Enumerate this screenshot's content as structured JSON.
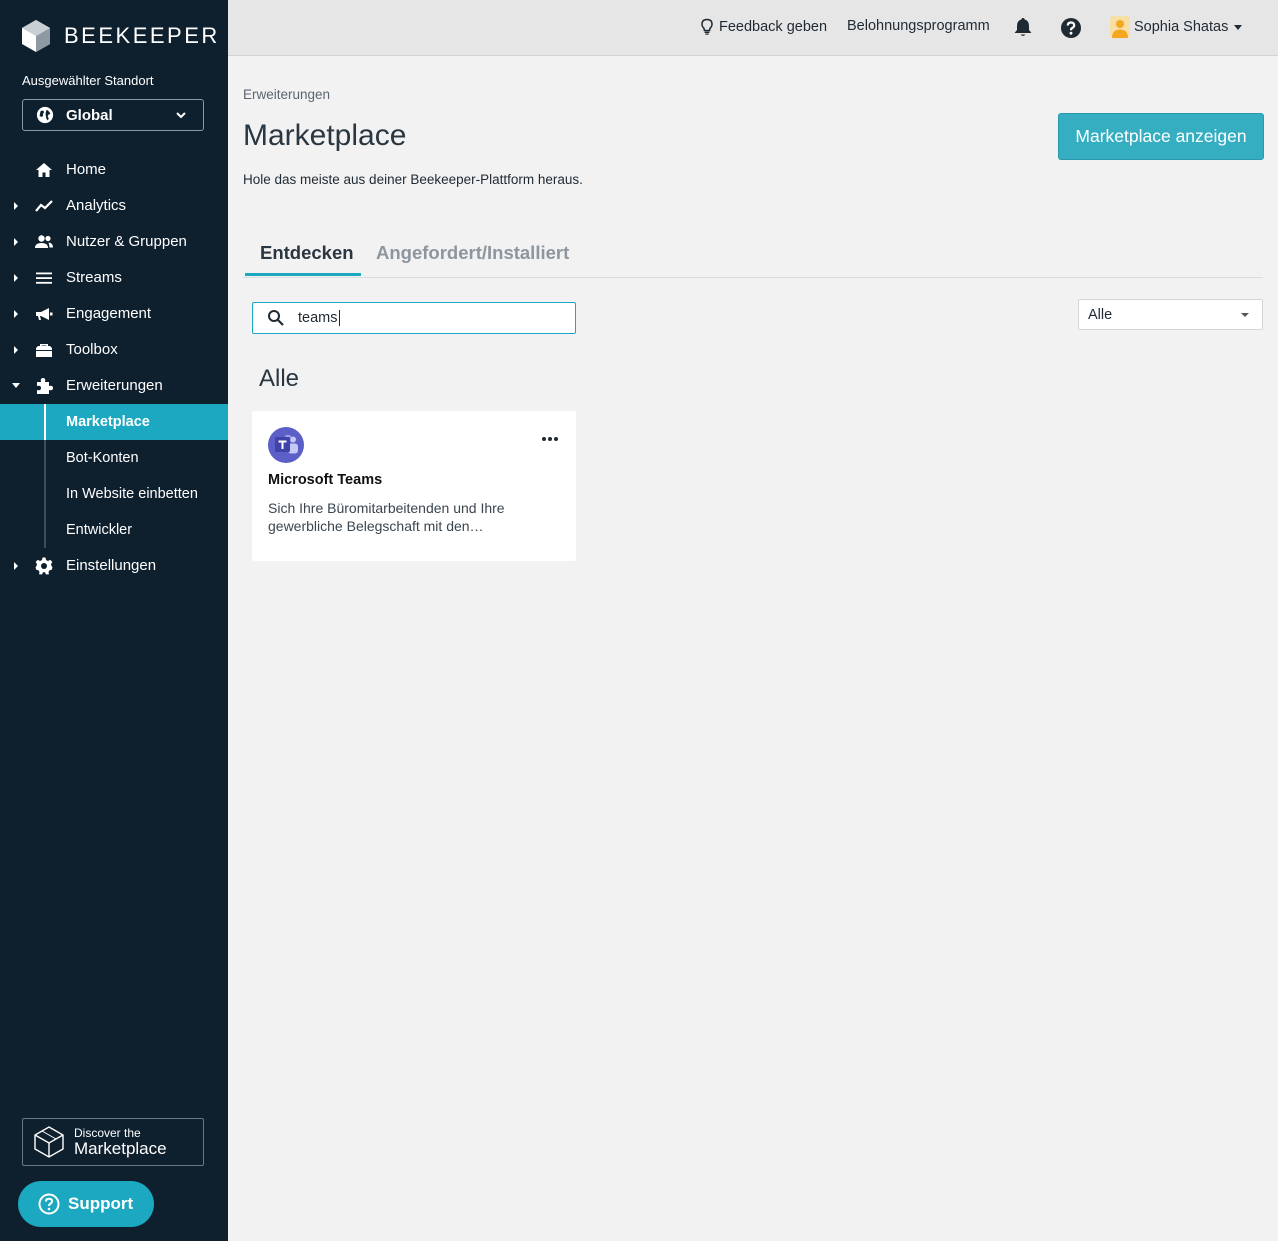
{
  "app": {
    "brand": "BEEKEEPER"
  },
  "sidebar": {
    "location_label": "Ausgewählter Standort",
    "location_value": "Global",
    "items": [
      {
        "label": "Home",
        "icon": "home-icon"
      },
      {
        "label": "Analytics",
        "icon": "analytics-icon"
      },
      {
        "label": "Nutzer & Gruppen",
        "icon": "users-icon"
      },
      {
        "label": "Streams",
        "icon": "streams-icon"
      },
      {
        "label": "Engagement",
        "icon": "megaphone-icon"
      },
      {
        "label": "Toolbox",
        "icon": "toolbox-icon"
      },
      {
        "label": "Erweiterungen",
        "icon": "puzzle-icon"
      },
      {
        "label": "Einstellungen",
        "icon": "gear-icon"
      }
    ],
    "subitems": [
      {
        "label": "Marketplace",
        "active": true
      },
      {
        "label": "Bot-Konten"
      },
      {
        "label": "In Website einbetten"
      },
      {
        "label": "Entwickler"
      }
    ],
    "discover": {
      "line1": "Discover the",
      "line2": "Marketplace"
    },
    "support_label": "Support"
  },
  "topbar": {
    "feedback": "Feedback geben",
    "rewards": "Belohnungsprogramm",
    "user_name": "Sophia Shatas"
  },
  "main": {
    "breadcrumb": "Erweiterungen",
    "title": "Marketplace",
    "subtitle": "Hole das meiste aus deiner Beekeeper-Plattform heraus.",
    "cta_button": "Marketplace anzeigen",
    "tabs": [
      {
        "label": "Entdecken",
        "active": true
      },
      {
        "label": "Angefordert/Installiert",
        "active": false
      }
    ],
    "search_value": "teams",
    "filter_value": "Alle",
    "section_title": "Alle",
    "cards": [
      {
        "title": "Microsoft Teams",
        "description": "Sich Ihre Büromitarbeitenden und Ihre gewerbliche Belegschaft mit den…",
        "icon": "microsoft-teams-icon"
      }
    ]
  },
  "colors": {
    "sidebar_bg": "#0e1f2e",
    "accent": "#1ba8c0",
    "cta": "#35aec2",
    "page_bg": "#f2f2f2",
    "teams_purple": "#5b5fc7"
  }
}
